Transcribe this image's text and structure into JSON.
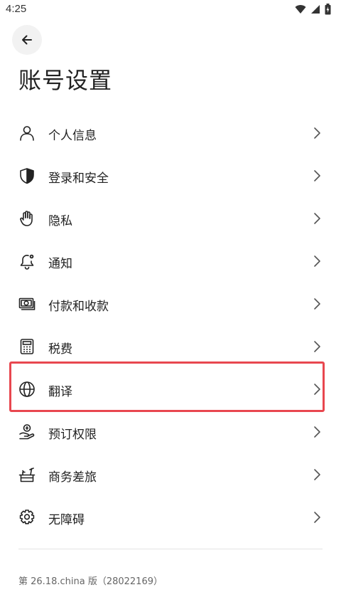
{
  "status_bar": {
    "time": "4:25",
    "icons": [
      "wifi-icon",
      "signal-icon",
      "battery-icon"
    ]
  },
  "header": {
    "back_icon": "arrow-left-icon",
    "title": "账号设置"
  },
  "menu": {
    "items": [
      {
        "label": "个人信息",
        "icon": "person-icon"
      },
      {
        "label": "登录和安全",
        "icon": "shield-icon"
      },
      {
        "label": "隐私",
        "icon": "hand-icon"
      },
      {
        "label": "通知",
        "icon": "bell-settings-icon"
      },
      {
        "label": "付款和收款",
        "icon": "money-icon"
      },
      {
        "label": "税费",
        "icon": "calculator-icon"
      },
      {
        "label": "翻译",
        "icon": "globe-icon",
        "highlighted": true
      },
      {
        "label": "预订权限",
        "icon": "hand-holding-icon"
      },
      {
        "label": "商务差旅",
        "icon": "desk-icon"
      },
      {
        "label": "无障碍",
        "icon": "gear-icon"
      }
    ],
    "chevron_icon": "chevron-right-icon"
  },
  "footer": {
    "version": "第 26.18.china 版（28022169）"
  },
  "colors": {
    "highlight_border": "#e8474f",
    "text": "#222222",
    "secondary_text": "#666666"
  }
}
